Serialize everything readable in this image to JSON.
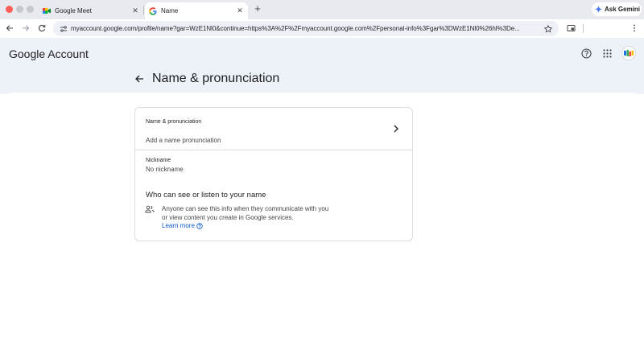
{
  "browser": {
    "tabs": [
      {
        "title": "Google Meet",
        "active": false
      },
      {
        "title": "Name",
        "active": true
      }
    ],
    "new_tab_symbol": "+",
    "gemini_label": "Ask Gemini",
    "url": "myaccount.google.com/profile/name?gar=WzE1Nl0&continue=https%3A%2F%2Fmyaccount.google.com%2Fpersonal-info%3Fgar%3DWzE1Nl0%26hl%3De..."
  },
  "header": {
    "brand_google": "Google",
    "brand_account": "Account",
    "icons": [
      "help-icon",
      "apps-grid-icon",
      "avatar"
    ]
  },
  "page": {
    "title": "Name & pronunciation"
  },
  "card": {
    "pronunciation": {
      "label": "Name & pronunciation",
      "value": "Add a name pronunciation"
    },
    "nickname": {
      "label": "Nickname",
      "value": "No nickname"
    },
    "visibility": {
      "title": "Who can see or listen to your name",
      "text": "Anyone can see this info when they communicate with you or view content you create in Google services.",
      "learn_more": "Learn more"
    }
  },
  "colors": {
    "header_bg": "#edf1f8",
    "link": "#0b57d0",
    "border": "#dadce0",
    "tabstrip_bg": "#e8eaf0"
  }
}
